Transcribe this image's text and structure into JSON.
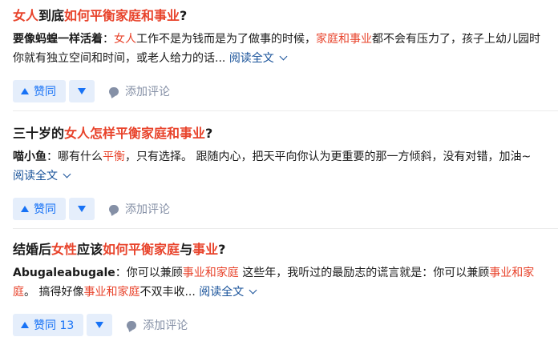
{
  "items": [
    {
      "title": [
        {
          "t": "女人",
          "hl": true
        },
        {
          "t": "到底",
          "hl": false
        },
        {
          "t": "如何平衡家庭和事业",
          "hl": true
        },
        {
          "t": "?",
          "hl": false
        }
      ],
      "author": "要像蚂蝗一样活着",
      "sep": "：",
      "excerpt": [
        {
          "t": "女人",
          "hl": true
        },
        {
          "t": "工作不是为钱而是为了做事的时候，",
          "hl": false
        },
        {
          "t": "家庭和事业",
          "hl": true
        },
        {
          "t": "都不会有压力了，孩子上幼儿园时你就有独立空间和时间，或老人给力的话... ",
          "hl": false
        }
      ],
      "readmore": "阅读全文",
      "upvote": "赞同",
      "comment": "添加评论"
    },
    {
      "title": [
        {
          "t": "三十岁的",
          "hl": false
        },
        {
          "t": "女人怎样平衡家庭和事业",
          "hl": true
        },
        {
          "t": "?",
          "hl": false
        }
      ],
      "author": "喵小鱼",
      "sep": "：",
      "excerpt": [
        {
          "t": "哪有什么",
          "hl": false
        },
        {
          "t": "平衡",
          "hl": true
        },
        {
          "t": "，只有选择。 跟随内心，把天平向你认为更重要的那一方倾斜，没有对错，加油~ ",
          "hl": false
        }
      ],
      "readmore": "阅读全文",
      "upvote": "赞同",
      "comment": "添加评论"
    },
    {
      "title": [
        {
          "t": "结婚后",
          "hl": false
        },
        {
          "t": "女性",
          "hl": true
        },
        {
          "t": "应该",
          "hl": false
        },
        {
          "t": "如何平衡家庭",
          "hl": true
        },
        {
          "t": "与",
          "hl": false
        },
        {
          "t": "事业",
          "hl": true
        },
        {
          "t": "?",
          "hl": false
        }
      ],
      "author": "Abugaleabugale",
      "sep": "：",
      "excerpt": [
        {
          "t": "你可以兼顾",
          "hl": false
        },
        {
          "t": "事业和家庭",
          "hl": true
        },
        {
          "t": " 这些年，我听过的最励志的谎言就是：你可以兼顾",
          "hl": false
        },
        {
          "t": "事业和家庭",
          "hl": true
        },
        {
          "t": "。 搞得好像",
          "hl": false
        },
        {
          "t": "事业和家庭",
          "hl": true
        },
        {
          "t": "不双丰收... ",
          "hl": false
        }
      ],
      "readmore": "阅读全文",
      "upvote": "赞同 13",
      "comment": "添加评论"
    }
  ],
  "colors": {
    "highlight": "#e8432b",
    "link": "#175199",
    "vote_bg": "#e5eefb",
    "vote_fg": "#1772f6",
    "muted": "#8590a6"
  }
}
